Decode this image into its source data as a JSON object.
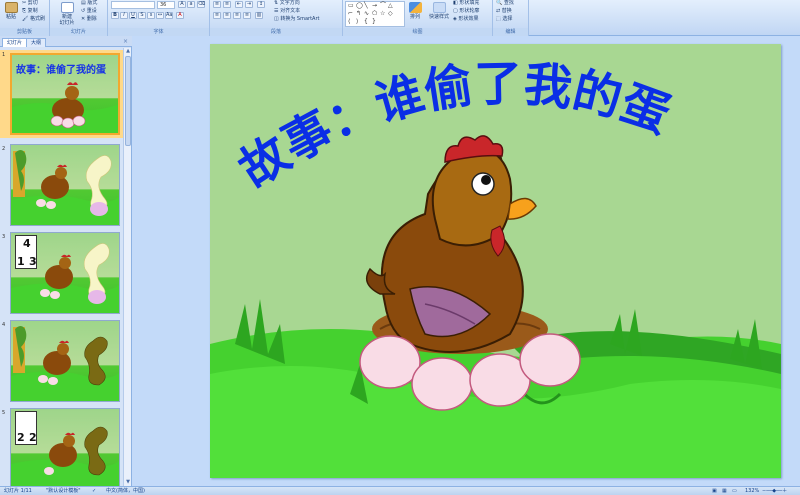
{
  "ribbon": {
    "clipboard": {
      "paste": "粘贴",
      "cut": "剪切",
      "copy": "复制",
      "format_painter": "格式刷",
      "group_label": "剪贴板"
    },
    "slides": {
      "new_slide_line1": "新建",
      "new_slide_line2": "幻灯片",
      "layout": "版式",
      "reset": "重设",
      "delete": "删除",
      "group_label": "幻灯片"
    },
    "font": {
      "font_name": "",
      "font_size": "36",
      "group_label": "字体"
    },
    "paragraph": {
      "text_direction": "文字方向",
      "align_text": "对齐文本",
      "convert_smartart": "转换为 SmartArt",
      "group_label": "段落"
    },
    "drawing": {
      "arrange": "排列",
      "quick_styles": "快速样式",
      "shape_fill": "形状填充",
      "shape_outline": "形状轮廓",
      "shape_effects": "形状效果",
      "group_label": "绘图"
    },
    "editing": {
      "find": "查找",
      "replace": "替换",
      "select": "选择",
      "group_label": "编辑"
    }
  },
  "left_pane": {
    "tabs": [
      "幻灯片",
      "大纲"
    ],
    "close": "×",
    "thumbnails": [
      {
        "number": "1",
        "title": "故事：谁偷了我的蛋",
        "numbers": []
      },
      {
        "number": "2",
        "title": "",
        "numbers": []
      },
      {
        "number": "3",
        "title": "",
        "numbers": [
          "4",
          "1",
          "3"
        ]
      },
      {
        "number": "4",
        "title": "",
        "numbers": []
      },
      {
        "number": "5",
        "title": "",
        "numbers": [
          "2",
          "2"
        ]
      }
    ]
  },
  "slide": {
    "title": "故事：谁偷了我的蛋"
  },
  "status_bar": {
    "slide_position": "幻灯片 1/11",
    "theme": "\"默认设计模板\"",
    "language": "中文(简体，中国)",
    "zoom": "132%"
  },
  "colors": {
    "title_blue": "#0a2ee6",
    "sky_green": "#a8d792",
    "grass_green": "#45d12f",
    "hen_brown": "#8a4a0c",
    "comb_red": "#c9262a",
    "egg_pink": "#f9dce6",
    "selection_orange": "#f3a82e"
  }
}
